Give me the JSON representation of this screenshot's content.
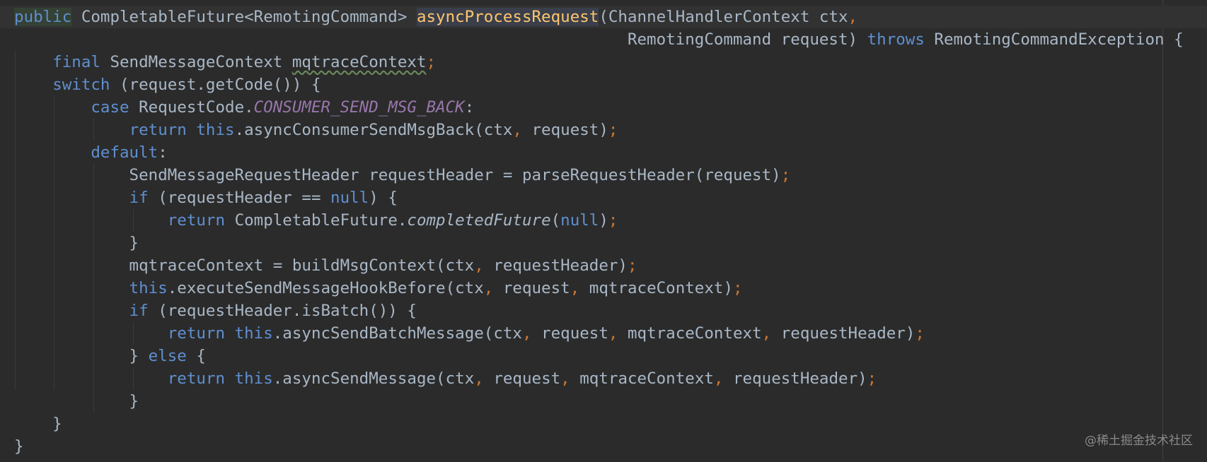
{
  "editor": {
    "lines": [
      [
        {
          "t": "public",
          "c": "kwb usage-bg"
        },
        {
          "t": " CompletableFuture<RemotingCommand> ",
          "c": ""
        },
        {
          "t": "asyncProcessRequest",
          "c": "hl sel-bg"
        },
        {
          "t": "(ChannelHandlerContext ctx",
          "c": ""
        },
        {
          "t": ",",
          "c": "semi"
        }
      ],
      [
        {
          "t": "                                                                RemotingCommand request) ",
          "c": ""
        },
        {
          "t": "throws",
          "c": "kwb"
        },
        {
          "t": " RemotingCommandException {",
          "c": ""
        }
      ],
      [
        {
          "t": "    ",
          "c": ""
        },
        {
          "t": "final",
          "c": "kwb"
        },
        {
          "t": " SendMessageContext ",
          "c": ""
        },
        {
          "t": "mqtraceContext",
          "c": "warn"
        },
        {
          "t": ";",
          "c": "semi"
        }
      ],
      [
        {
          "t": "    ",
          "c": ""
        },
        {
          "t": "switch",
          "c": "kwb"
        },
        {
          "t": " (request.getCode()) {",
          "c": ""
        }
      ],
      [
        {
          "t": "        ",
          "c": ""
        },
        {
          "t": "case",
          "c": "kwb"
        },
        {
          "t": " RequestCode.",
          "c": ""
        },
        {
          "t": "CONSUMER_SEND_MSG_BACK",
          "c": "const"
        },
        {
          "t": ":",
          "c": ""
        }
      ],
      [
        {
          "t": "            ",
          "c": ""
        },
        {
          "t": "return",
          "c": "kwb"
        },
        {
          "t": " ",
          "c": ""
        },
        {
          "t": "this",
          "c": "kwb"
        },
        {
          "t": ".asyncConsumerSendMsgBack(ctx",
          "c": ""
        },
        {
          "t": ",",
          "c": "semi"
        },
        {
          "t": " request)",
          "c": ""
        },
        {
          "t": ";",
          "c": "semi"
        }
      ],
      [
        {
          "t": "        ",
          "c": ""
        },
        {
          "t": "default",
          "c": "kwb"
        },
        {
          "t": ":",
          "c": ""
        }
      ],
      [
        {
          "t": "            SendMessageRequestHeader requestHeader = parseRequestHeader(request)",
          "c": ""
        },
        {
          "t": ";",
          "c": "semi"
        }
      ],
      [
        {
          "t": "            ",
          "c": ""
        },
        {
          "t": "if",
          "c": "kwb"
        },
        {
          "t": " (requestHeader == ",
          "c": ""
        },
        {
          "t": "null",
          "c": "kwb"
        },
        {
          "t": ") {",
          "c": ""
        }
      ],
      [
        {
          "t": "                ",
          "c": ""
        },
        {
          "t": "return",
          "c": "kwb"
        },
        {
          "t": " CompletableFuture.",
          "c": ""
        },
        {
          "t": "completedFuture",
          "c": "ital"
        },
        {
          "t": "(",
          "c": ""
        },
        {
          "t": "null",
          "c": "kwb"
        },
        {
          "t": ")",
          "c": ""
        },
        {
          "t": ";",
          "c": "semi"
        }
      ],
      [
        {
          "t": "            }",
          "c": ""
        }
      ],
      [
        {
          "t": "            mqtraceContext = buildMsgContext(ctx",
          "c": ""
        },
        {
          "t": ",",
          "c": "semi"
        },
        {
          "t": " requestHeader)",
          "c": ""
        },
        {
          "t": ";",
          "c": "semi"
        }
      ],
      [
        {
          "t": "            ",
          "c": ""
        },
        {
          "t": "this",
          "c": "kwb"
        },
        {
          "t": ".executeSendMessageHookBefore(ctx",
          "c": ""
        },
        {
          "t": ",",
          "c": "semi"
        },
        {
          "t": " request",
          "c": ""
        },
        {
          "t": ",",
          "c": "semi"
        },
        {
          "t": " mqtraceContext)",
          "c": ""
        },
        {
          "t": ";",
          "c": "semi"
        }
      ],
      [
        {
          "t": "            ",
          "c": ""
        },
        {
          "t": "if",
          "c": "kwb"
        },
        {
          "t": " (requestHeader.isBatch()) {",
          "c": ""
        }
      ],
      [
        {
          "t": "                ",
          "c": ""
        },
        {
          "t": "return",
          "c": "kwb"
        },
        {
          "t": " ",
          "c": ""
        },
        {
          "t": "this",
          "c": "kwb"
        },
        {
          "t": ".asyncSendBatchMessage(ctx",
          "c": ""
        },
        {
          "t": ",",
          "c": "semi"
        },
        {
          "t": " request",
          "c": ""
        },
        {
          "t": ",",
          "c": "semi"
        },
        {
          "t": " mqtraceContext",
          "c": ""
        },
        {
          "t": ",",
          "c": "semi"
        },
        {
          "t": " requestHeader)",
          "c": ""
        },
        {
          "t": ";",
          "c": "semi"
        }
      ],
      [
        {
          "t": "            } ",
          "c": ""
        },
        {
          "t": "else",
          "c": "kwb"
        },
        {
          "t": " {",
          "c": ""
        }
      ],
      [
        {
          "t": "                ",
          "c": ""
        },
        {
          "t": "return",
          "c": "kwb"
        },
        {
          "t": " ",
          "c": ""
        },
        {
          "t": "this",
          "c": "kwb"
        },
        {
          "t": ".asyncSendMessage(ctx",
          "c": ""
        },
        {
          "t": ",",
          "c": "semi"
        },
        {
          "t": " request",
          "c": ""
        },
        {
          "t": ",",
          "c": "semi"
        },
        {
          "t": " mqtraceContext",
          "c": ""
        },
        {
          "t": ",",
          "c": "semi"
        },
        {
          "t": " requestHeader)",
          "c": ""
        },
        {
          "t": ";",
          "c": "semi"
        }
      ],
      [
        {
          "t": "            }",
          "c": ""
        }
      ],
      [
        {
          "t": "    }",
          "c": ""
        }
      ],
      [
        {
          "t": "}",
          "c": ""
        }
      ]
    ]
  },
  "watermark": "@稀土掘金技术社区",
  "colors": {
    "background": "#2b2b2b",
    "text": "#a9b7c6",
    "keyword": "#5f8fd0",
    "method_highlight": "#ffc66d",
    "constant": "#9876aa",
    "punctuation": "#cc7832"
  }
}
